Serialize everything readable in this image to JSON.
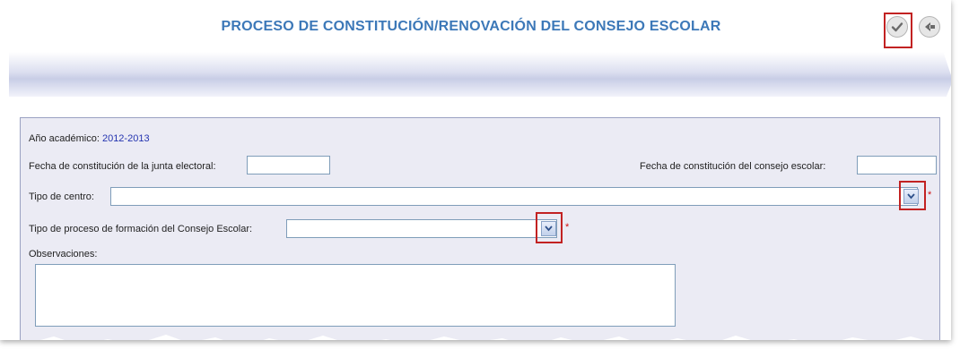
{
  "header": {
    "title": "PROCESO DE CONSTITUCIÓN/RENOVACIÓN DEL CONSEJO ESCOLAR",
    "confirm_icon": "checkmark-circle-icon",
    "back_icon": "arrow-left-circle-icon"
  },
  "form": {
    "academic_year_label": "Año académico:",
    "academic_year_value": "2012-2013",
    "electoral_board_date_label": "Fecha de constitución de la junta electoral:",
    "electoral_board_date_value": "",
    "council_date_label": "Fecha de constitución del consejo escolar:",
    "council_date_value": "",
    "center_type_label": "Tipo de centro:",
    "center_type_value": "",
    "process_type_label": "Tipo de proceso de formación del Consejo Escolar:",
    "process_type_value": "",
    "observations_label": "Observaciones:",
    "observations_value": "",
    "required_mark": "*"
  },
  "colors": {
    "title": "#3c78b8",
    "value": "#2434b0",
    "highlight": "#c22222",
    "required": "#d01010"
  }
}
